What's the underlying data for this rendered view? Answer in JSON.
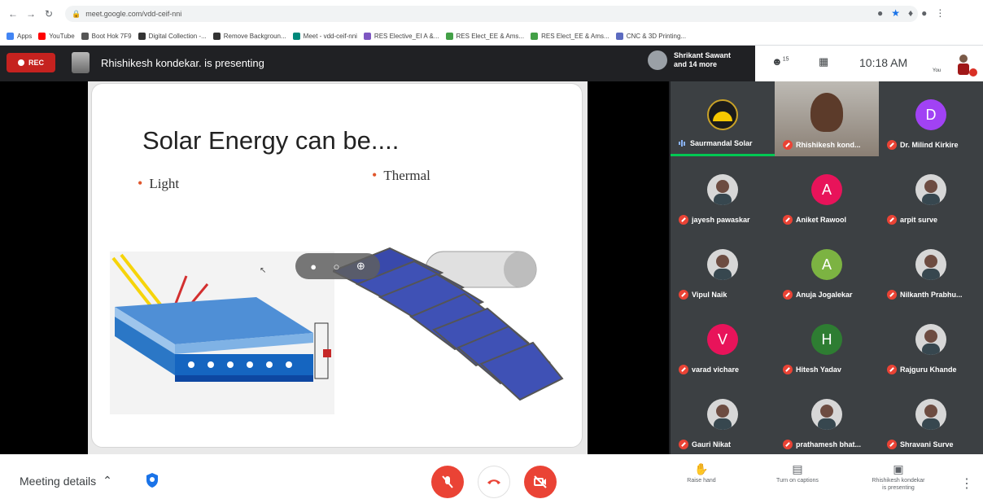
{
  "browser": {
    "url": "meet.google.com/vdd-ceif-nni",
    "bookmarks": [
      {
        "label": "Apps",
        "color": "#4285f4"
      },
      {
        "label": "YouTube",
        "color": "#ff0000"
      },
      {
        "label": "Boot Hok 7F9",
        "color": "#555555"
      },
      {
        "label": "Digital Collection -...",
        "color": "#333333"
      },
      {
        "label": "Remove Backgroun...",
        "color": "#333333"
      },
      {
        "label": "Meet - vdd-ceif-nni",
        "color": "#00897b"
      },
      {
        "label": "RES Elective_EI A &...",
        "color": "#7e57c2"
      },
      {
        "label": "RES Elect_EE & Ams...",
        "color": "#43a047"
      },
      {
        "label": "RES Elect_EE & Ams...",
        "color": "#43a047"
      },
      {
        "label": "CNC & 3D Printing...",
        "color": "#5c6bc0"
      }
    ]
  },
  "meet": {
    "rec_label": "REC",
    "presenting_text": "Rhishikesh kondekar. is presenting",
    "people_line1": "Shrikant Sawant",
    "people_line2": "and 14 more",
    "participant_count": "15",
    "clock": "10:18 AM",
    "you_label": "You"
  },
  "slide": {
    "title": "Solar Energy can be....",
    "bullets": [
      "Light",
      "Thermal"
    ]
  },
  "participants": [
    {
      "name": "Saurmandal Solar",
      "kind": "logo",
      "speaking": true
    },
    {
      "name": "Rhishikesh kond...",
      "kind": "video"
    },
    {
      "name": "Dr. Milind Kirkire",
      "kind": "letter",
      "letter": "D",
      "color": "#a142f4"
    },
    {
      "name": "jayesh pawaskar",
      "kind": "photo"
    },
    {
      "name": "Aniket Rawool",
      "kind": "letter",
      "letter": "A",
      "color": "#e8135a"
    },
    {
      "name": "arpit surve",
      "kind": "photo"
    },
    {
      "name": "Vipul Naik",
      "kind": "photo"
    },
    {
      "name": "Anuja Jogalekar",
      "kind": "letter",
      "letter": "A",
      "color": "#7cb342"
    },
    {
      "name": "Nilkanth Prabhu...",
      "kind": "photo"
    },
    {
      "name": "varad vichare",
      "kind": "letter",
      "letter": "V",
      "color": "#e8135a"
    },
    {
      "name": "Hitesh Yadav",
      "kind": "letter",
      "letter": "H",
      "color": "#2e7d32"
    },
    {
      "name": "Rajguru Khande",
      "kind": "photo"
    },
    {
      "name": "Gauri Nikat",
      "kind": "photo"
    },
    {
      "name": "prathamesh bhat...",
      "kind": "photo"
    },
    {
      "name": "Shravani Surve",
      "kind": "photo"
    }
  ],
  "bottom": {
    "meeting_details": "Meeting details",
    "raise_hand": "Raise hand",
    "captions": "Turn on captions",
    "presenting_line1": "Rhishikesh kondekar",
    "presenting_line2": "is presenting"
  }
}
